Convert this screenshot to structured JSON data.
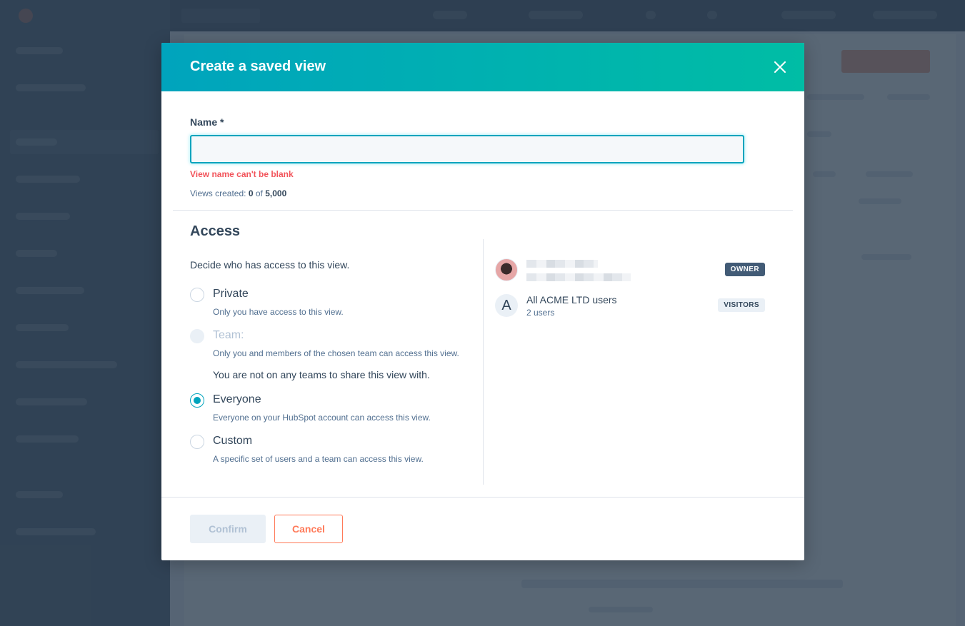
{
  "modal": {
    "title": "Create a saved view",
    "close_icon": "close-icon"
  },
  "name_field": {
    "label": "Name *",
    "value": "",
    "placeholder": "",
    "error": "View name can't be blank",
    "views_created_label": "Views created:",
    "views_created_count": "0",
    "views_created_of": "of",
    "views_created_limit": "5,000"
  },
  "access": {
    "title": "Access",
    "description": "Decide who has access to this view.",
    "options": [
      {
        "label": "Private",
        "help": "Only you have access to this view.",
        "checked": false,
        "disabled": false
      },
      {
        "label": "Team:",
        "help": "Only you and members of the chosen team can access this view.",
        "note": "You are not on any teams to share this view with.",
        "checked": false,
        "disabled": true
      },
      {
        "label": "Everyone",
        "help": "Everyone on your HubSpot account can access this view.",
        "checked": true,
        "disabled": false
      },
      {
        "label": "Custom",
        "help": "A specific set of users and a team can access this view.",
        "checked": false,
        "disabled": false
      }
    ],
    "members": [
      {
        "avatar": "user-photo",
        "badge": "OWNER"
      },
      {
        "avatar_letter": "A",
        "name": "All ACME LTD users",
        "sub": "2 users",
        "badge": "VISITORS"
      }
    ]
  },
  "footer": {
    "confirm_label": "Confirm",
    "cancel_label": "Cancel"
  },
  "colors": {
    "header_start": "#00a4bd",
    "header_end": "#00bda5",
    "error": "#f2545b",
    "accent": "#00a4bd",
    "cancel": "#ff7a59"
  }
}
